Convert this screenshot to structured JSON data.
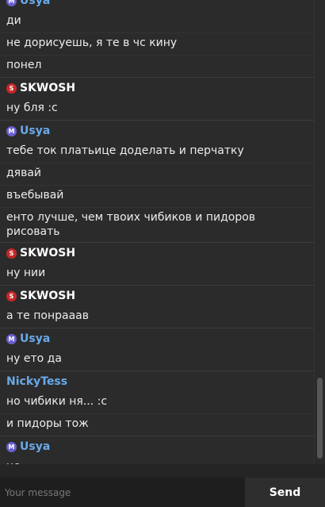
{
  "colors": {
    "skwosh_badge": "#c62828",
    "usya_badge": "#6b5fcf",
    "skwosh_name": "#ffffff",
    "usya_name": "#6aa9ea",
    "nickytess_name": "#6aa9ea"
  },
  "messages": [
    {
      "author": "Usya",
      "badge_icon": "M",
      "badge_color": "#6b5fcf",
      "name_color": "#6aa9ea",
      "lines": [
        "ди",
        "не дорисуешь, я те в чс кину",
        "понел"
      ]
    },
    {
      "author": "SKWOSH",
      "badge_icon": "S",
      "badge_color": "#c62828",
      "name_color": "#ffffff",
      "lines": [
        "ну бля :с"
      ]
    },
    {
      "author": "Usya",
      "badge_icon": "M",
      "badge_color": "#6b5fcf",
      "name_color": "#6aa9ea",
      "lines": [
        "тебе ток платьице доделать и перчатку",
        "дявай",
        "въебывай",
        "енто лучше, чем твоих чибиков и пидоров рисовать"
      ]
    },
    {
      "author": "SKWOSH",
      "badge_icon": "S",
      "badge_color": "#c62828",
      "name_color": "#ffffff",
      "lines": [
        "ну нии"
      ]
    },
    {
      "author": "SKWOSH",
      "badge_icon": "S",
      "badge_color": "#c62828",
      "name_color": "#ffffff",
      "lines": [
        "а те понрааав"
      ]
    },
    {
      "author": "Usya",
      "badge_icon": "M",
      "badge_color": "#6b5fcf",
      "name_color": "#6aa9ea",
      "lines": [
        "ну ето да"
      ]
    },
    {
      "author": "NickyTess",
      "badge_icon": "",
      "badge_color": "",
      "name_color": "#6aa9ea",
      "lines": [
        "но чибики ня... :с",
        "и пидоры тож"
      ]
    },
    {
      "author": "Usya",
      "badge_icon": "M",
      "badge_color": "#6b5fcf",
      "name_color": "#6aa9ea",
      "lines": [
        "не"
      ]
    }
  ],
  "composer": {
    "placeholder": "Your message",
    "send_label": "Send"
  }
}
